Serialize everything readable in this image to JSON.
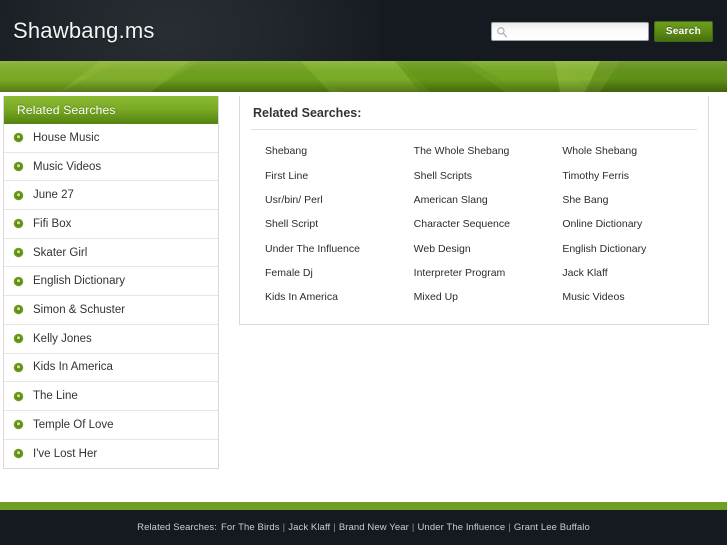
{
  "header": {
    "site_title": "Shawbang.ms",
    "search": {
      "value": "",
      "placeholder": "",
      "icon": "search-icon",
      "button_label": "Search"
    }
  },
  "sidebar": {
    "header_label": "Related Searches",
    "bullet_icon": "green-circle-bullet-icon",
    "items": [
      {
        "label": "House Music"
      },
      {
        "label": "Music Videos"
      },
      {
        "label": "June 27"
      },
      {
        "label": "Fifi Box"
      },
      {
        "label": "Skater Girl"
      },
      {
        "label": "English Dictionary"
      },
      {
        "label": "Simon & Schuster"
      },
      {
        "label": "Kelly Jones"
      },
      {
        "label": "Kids In America"
      },
      {
        "label": "The Line"
      },
      {
        "label": "Temple Of Love"
      },
      {
        "label": "I've Lost Her"
      }
    ]
  },
  "main": {
    "title": "Related Searches:",
    "links": [
      "Shebang",
      "The Whole Shebang",
      "Whole Shebang",
      "First Line",
      "Shell Scripts",
      "Timothy Ferris",
      "Usr/bin/ Perl",
      "American Slang",
      "She Bang",
      "Shell Script",
      "Character Sequence",
      "Online Dictionary",
      "Under The Influence",
      "Web Design",
      "English Dictionary",
      "Female Dj",
      "Interpreter Program",
      "Jack Klaff",
      "Kids In America",
      "Mixed Up",
      "Music Videos"
    ]
  },
  "footer": {
    "label": "Related Searches:",
    "separator": "|",
    "links": [
      "For The Birds",
      "Jack Klaff",
      "Brand New Year",
      "Under The Influence",
      "Grant Lee Buffalo"
    ]
  },
  "colors": {
    "accent_green": "#6f9f22",
    "header_dark": "#141a20",
    "banner_green": "#6ea21f",
    "button_green": "#5d8b16"
  }
}
